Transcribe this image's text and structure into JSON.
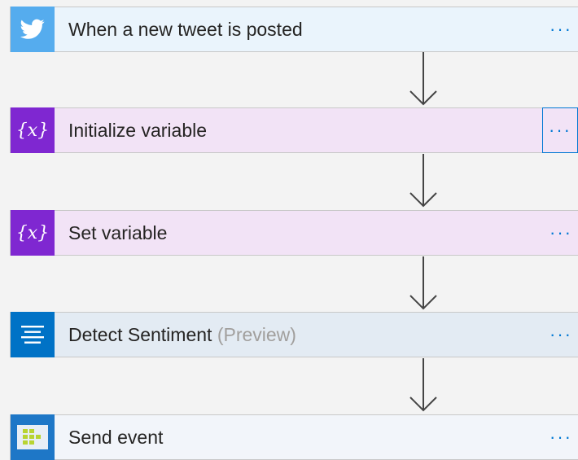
{
  "steps": [
    {
      "title": "When a new tweet is posted",
      "icon": "twitter-bird-icon",
      "more": "···"
    },
    {
      "title": "Initialize variable",
      "icon": "variable-icon",
      "icon_text": "{x}",
      "more": "···"
    },
    {
      "title": "Set variable",
      "icon": "variable-icon",
      "icon_text": "{x}",
      "more": "···"
    },
    {
      "title": "Detect Sentiment",
      "suffix": "(Preview)",
      "icon": "text-analytics-icon",
      "more": "···"
    },
    {
      "title": "Send event",
      "icon": "event-hub-icon",
      "more": "···"
    }
  ],
  "colors": {
    "accent": "#0078d4",
    "twitter": "#55acee",
    "variable": "#7f27d1",
    "sentiment": "#0072c6",
    "event_hub": "#1e77c7"
  }
}
